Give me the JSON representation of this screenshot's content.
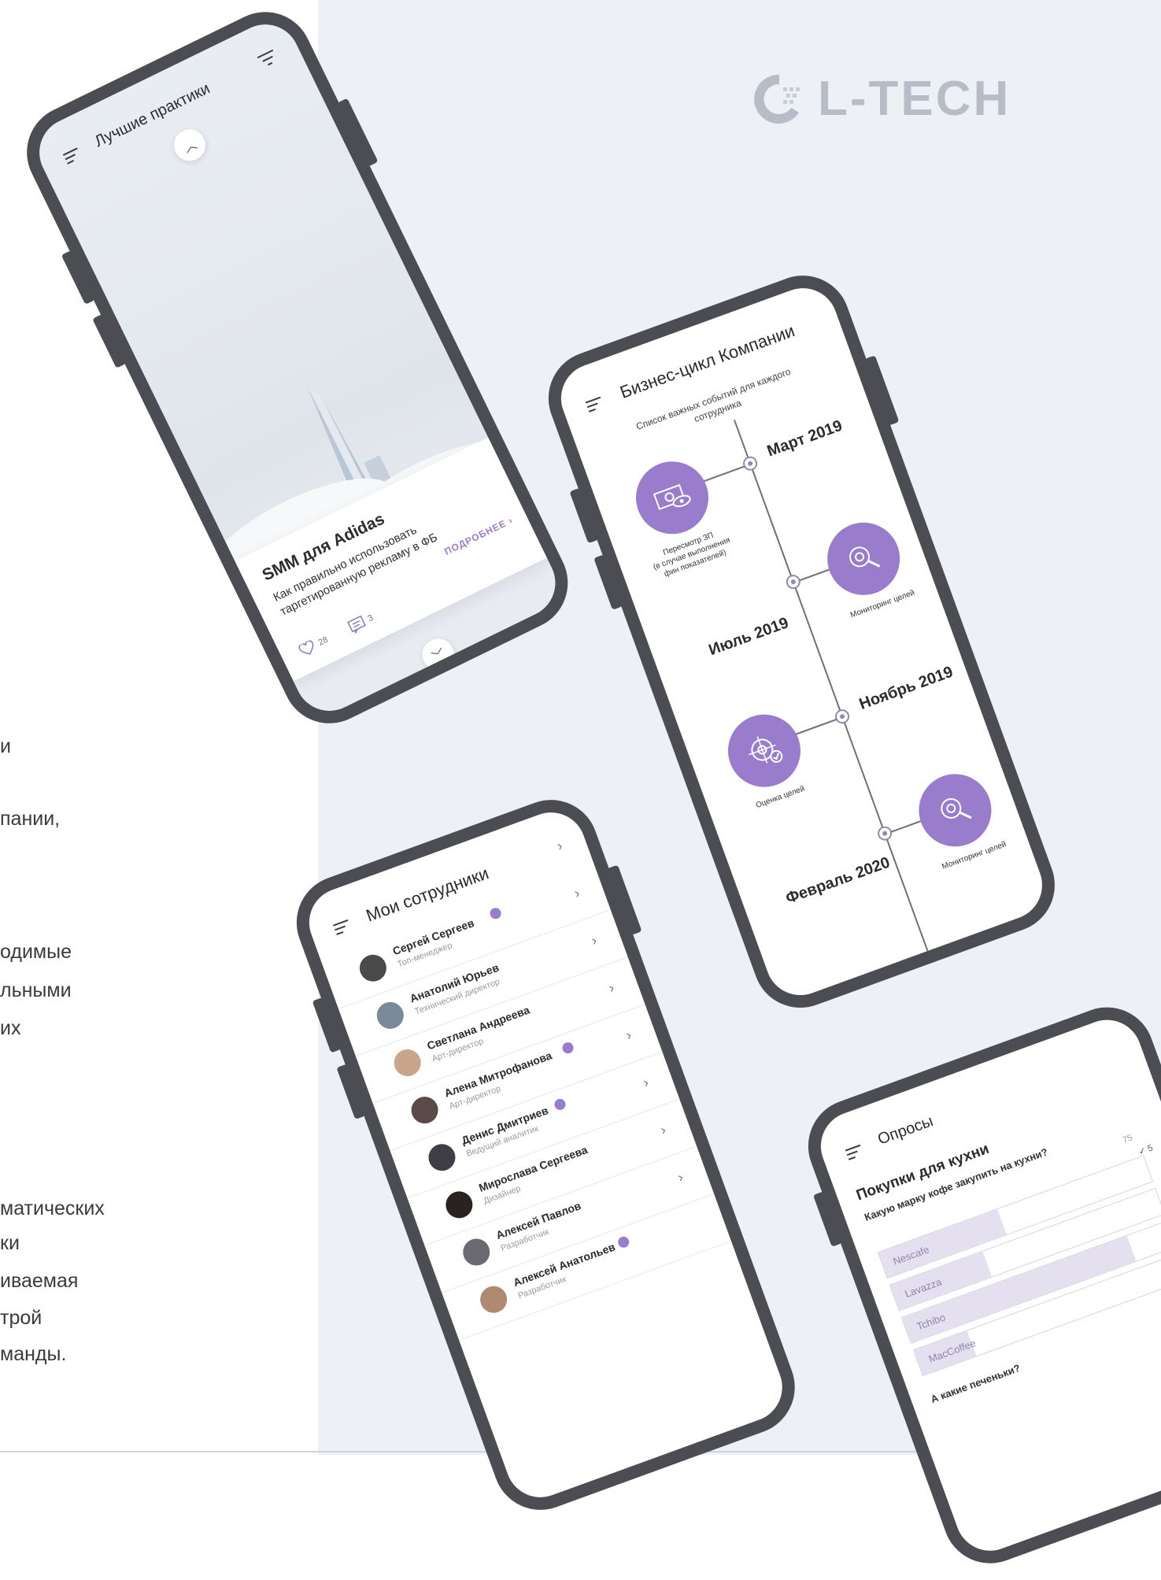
{
  "brand": {
    "name": "L-TECH"
  },
  "left_text": [
    {
      "text": "и"
    },
    {
      "text": "пании,"
    },
    {
      "text": "одимые"
    },
    {
      "text": "льными"
    },
    {
      "text": "их"
    },
    {
      "text": "матических"
    },
    {
      "text": "ки"
    },
    {
      "text": "иваемая"
    },
    {
      "text": "трой"
    },
    {
      "text": "манды."
    }
  ],
  "practices": {
    "title": "Лучшие практики",
    "card_title": "SMM для Adidas",
    "card_desc_1": "Как правильно использовать",
    "card_desc_2": "таргетированную рекламу в ФБ",
    "more": "ПОДРОБНЕЕ",
    "likes": "28",
    "comments": "3"
  },
  "cycle": {
    "title": "Бизнес-цикл Компании",
    "subtitle_1": "Список важных событий для каждого",
    "subtitle_2": "сотрудника",
    "events": [
      {
        "month": "Март 2019",
        "label_1": "Пересмотр ЗП",
        "label_2": "(в случае выполнения",
        "label_3": "фин показателей)",
        "icon": "money-eye-icon"
      },
      {
        "month": "Июль 2019",
        "label_1": "Мониторинг целей",
        "icon": "target-search-icon"
      },
      {
        "month": "Ноябрь 2019",
        "label_1": "Оценка целей",
        "icon": "target-check-icon"
      },
      {
        "month": "Февраль 2020",
        "label_1": "Мониторинг целей",
        "icon": "target-search-icon"
      }
    ]
  },
  "employees": {
    "title": "Мои сотрудники",
    "list": [
      {
        "name": "Сергей Сергеев",
        "role": "Топ-менеджер",
        "badge": true,
        "avatar": "#4a4a4a"
      },
      {
        "name": "Анатолий Юрьев",
        "role": "Технический директор",
        "badge": false,
        "avatar": "#7a8a9a"
      },
      {
        "name": "Светлана Андреева",
        "role": "Арт-директор",
        "badge": false,
        "avatar": "#c9a48a"
      },
      {
        "name": "Алена Митрофанова",
        "role": "Арт-директор",
        "badge": true,
        "avatar": "#5a4a48"
      },
      {
        "name": "Денис Дмитриев",
        "role": "Ведущий аналитик",
        "badge": true,
        "avatar": "#3e3e44"
      },
      {
        "name": "Мирослава Сергеева",
        "role": "Дизайнер",
        "badge": false,
        "avatar": "#2a2220"
      },
      {
        "name": "Алексей Павлов",
        "role": "Разработчик",
        "badge": false,
        "avatar": "#6a6a70"
      },
      {
        "name": "Алексей Анатольев",
        "role": "Разработчик",
        "badge": true,
        "avatar": "#b08a70"
      }
    ]
  },
  "polls": {
    "title": "Опросы",
    "section": "Покупки для кухни",
    "question": "Какую марку кофе закупить на кухни?",
    "count_a": "75",
    "count_b": "5",
    "options": [
      {
        "label": "Nescafe",
        "fill": 0.45
      },
      {
        "label": "Lavazza",
        "fill": 0.35
      },
      {
        "label": "Tchibo",
        "fill": 0.85
      },
      {
        "label": "MacCoffee",
        "fill": 0.2
      }
    ],
    "question_2": "А какие печеньки?"
  },
  "colors": {
    "accent": "#9a7ccc",
    "frame": "#4b4d52",
    "bg": "#edf0f4"
  }
}
